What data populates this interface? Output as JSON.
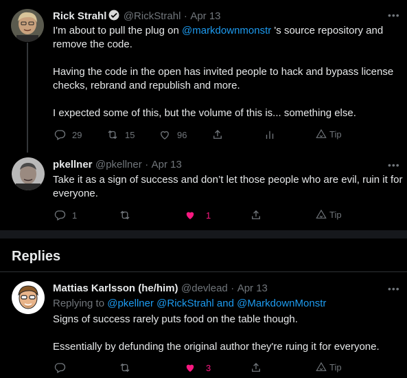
{
  "tweet1": {
    "name": "Rick Strahl",
    "handle": "@RickStrahl",
    "sep": "·",
    "date": "Apr 13",
    "text_part1": "I'm about to pull the plug on ",
    "mention": "@markdownmonstr",
    "text_part2": " 's source repository and\nremove the code.\n\nHaving the code in the open has invited people to hack and bypass license\nchecks, rebrand and republish and more.\n\nI expected some of this, but the volume of this is... something else.",
    "replies": "29",
    "retweets": "15",
    "likes": "96",
    "tip": "Tip"
  },
  "tweet2": {
    "name": "pkellner",
    "handle": "@pkellner",
    "sep": "·",
    "date": "Apr 13",
    "text": "Take it as a sign of success and don’t let those people who are evil, ruin it for\neveryone.",
    "replies": "1",
    "likes": "1",
    "tip": "Tip",
    "like_color": "#f91880"
  },
  "replies_header": "Replies",
  "tweet3": {
    "name": "Mattias Karlsson (he/him)",
    "handle": "@devlead",
    "sep": "·",
    "date": "Apr 13",
    "replying_to": "Replying to ",
    "mention1": "@pkellner",
    "mention2": "@RickStrahl",
    "and": " and ",
    "mention3": "@MarkdownMonstr",
    "text": "Signs of success rarely puts food on the table though.\n\nEssentially by defunding the original author they're ruing it for everyone.",
    "likes": "3",
    "tip": "Tip"
  },
  "more_icon": "•••",
  "colors": {
    "background": "#000000",
    "accent": "#1d9bf0",
    "muted": "#71767b",
    "like": "#f91880"
  }
}
